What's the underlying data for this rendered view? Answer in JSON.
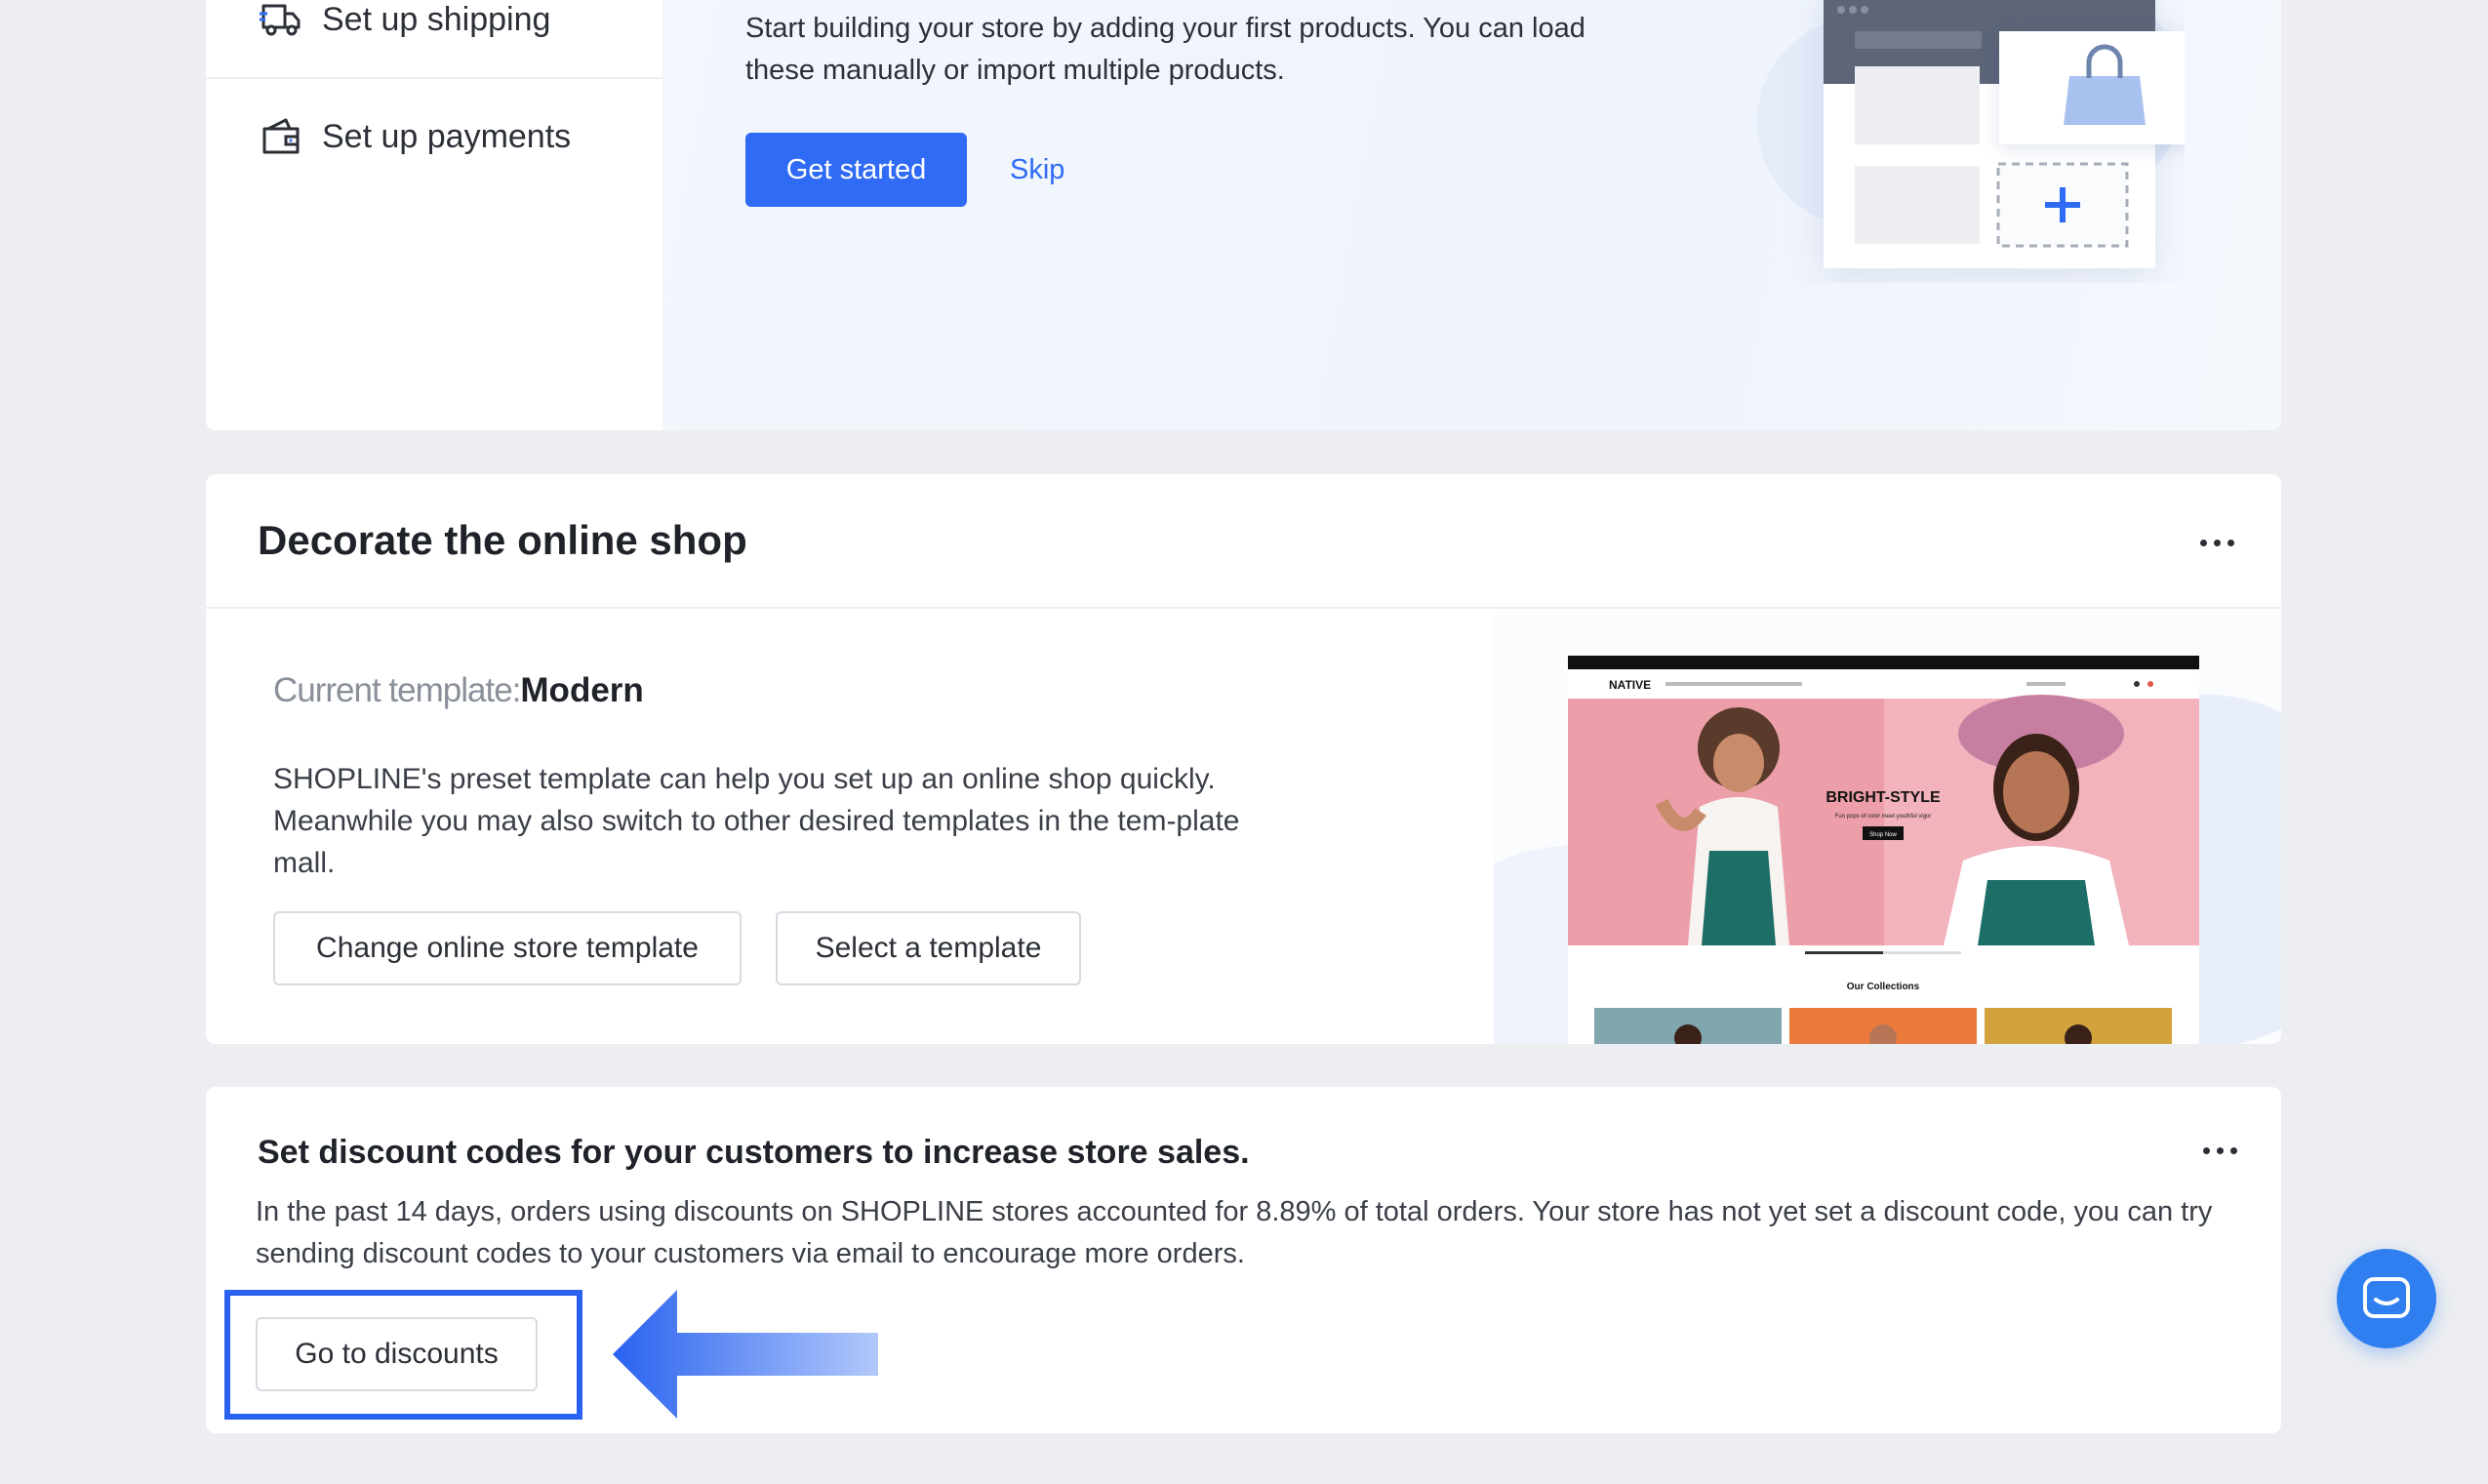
{
  "setup": {
    "steps": [
      {
        "label": "Set up shipping",
        "icon": "truck-icon"
      },
      {
        "label": "Set up payments",
        "icon": "wallet-icon"
      }
    ],
    "description": "Start building your store by adding your first products. You can load these manually or import multiple products.",
    "primary_button": "Get started",
    "skip_link": "Skip"
  },
  "decorate": {
    "title": "Decorate the online shop",
    "template_label": "Current template:",
    "template_name": "Modern",
    "description": "SHOPLINE's preset template can help you set up an online shop quickly. Meanwhile you may also switch to other desired templates in the tem-plate mall.",
    "buttons": {
      "change": "Change online store template",
      "select": "Select a template"
    },
    "preview": {
      "brand": "NATIVE",
      "hero_title": "BRIGHT-STYLE",
      "hero_subtitle": "Fun pops of color meet youthful vigor",
      "hero_button": "Shop Now",
      "collections_title": "Our Collections"
    }
  },
  "discount": {
    "title": "Set discount codes for your customers to increase store sales.",
    "description": "In the past 14 days, orders using discounts on SHOPLINE stores accounted for 8.89% of total orders. Your store has not yet set a discount code, you can try sending discount codes to your customers via email to encourage more orders.",
    "button": "Go to discounts"
  },
  "colors": {
    "primary": "#2f6bf5",
    "highlight": "#2962f0",
    "page_bg": "#edeef1"
  },
  "icons": {
    "more": "more-horizontal-icon",
    "chat": "chat-icon",
    "arrow": "arrow-left-icon"
  }
}
